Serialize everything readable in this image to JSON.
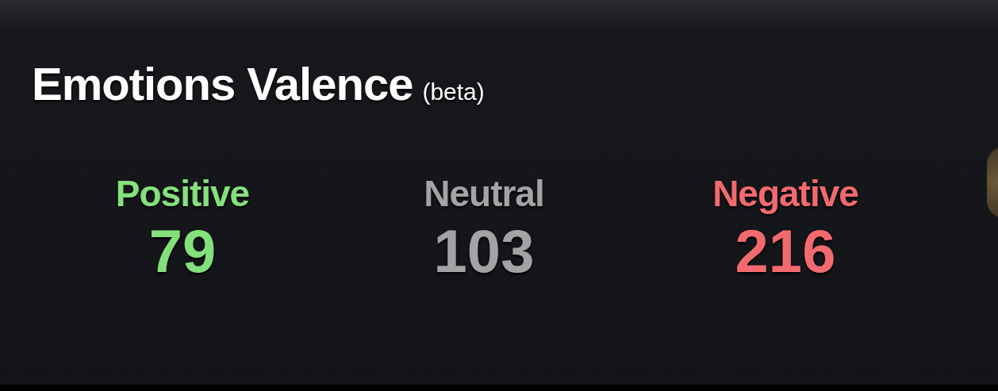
{
  "title": "Emotions Valence",
  "badge": "(beta)",
  "counts": [
    {
      "label": "Positive",
      "value": "79",
      "color": "#84e07c"
    },
    {
      "label": "Neutral",
      "value": "103",
      "color": "#a3a3a5"
    },
    {
      "label": "Negative",
      "value": "216",
      "color": "#f26a6e"
    }
  ]
}
